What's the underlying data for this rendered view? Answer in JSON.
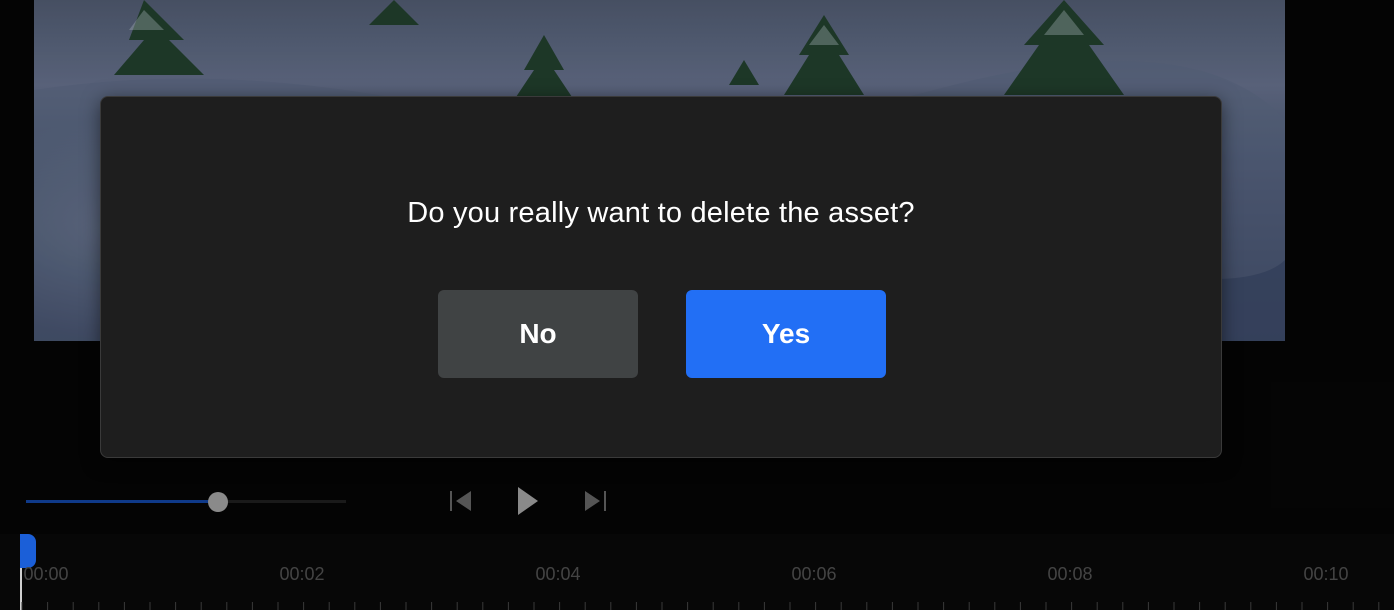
{
  "dialog": {
    "message": "Do you really want to delete the asset?",
    "no_label": "No",
    "yes_label": "Yes",
    "colors": {
      "background": "#1e1e1e",
      "no_button": "#404344",
      "yes_button": "#226ff5"
    }
  },
  "player": {
    "seek_progress": 0.6,
    "icons": [
      "skip-previous-icon",
      "play-icon",
      "skip-next-icon"
    ]
  },
  "timeline": {
    "labels": [
      "00:00",
      "00:02",
      "00:04",
      "00:06",
      "00:08",
      "00:10"
    ],
    "playhead_color": "#1b5fd8"
  }
}
